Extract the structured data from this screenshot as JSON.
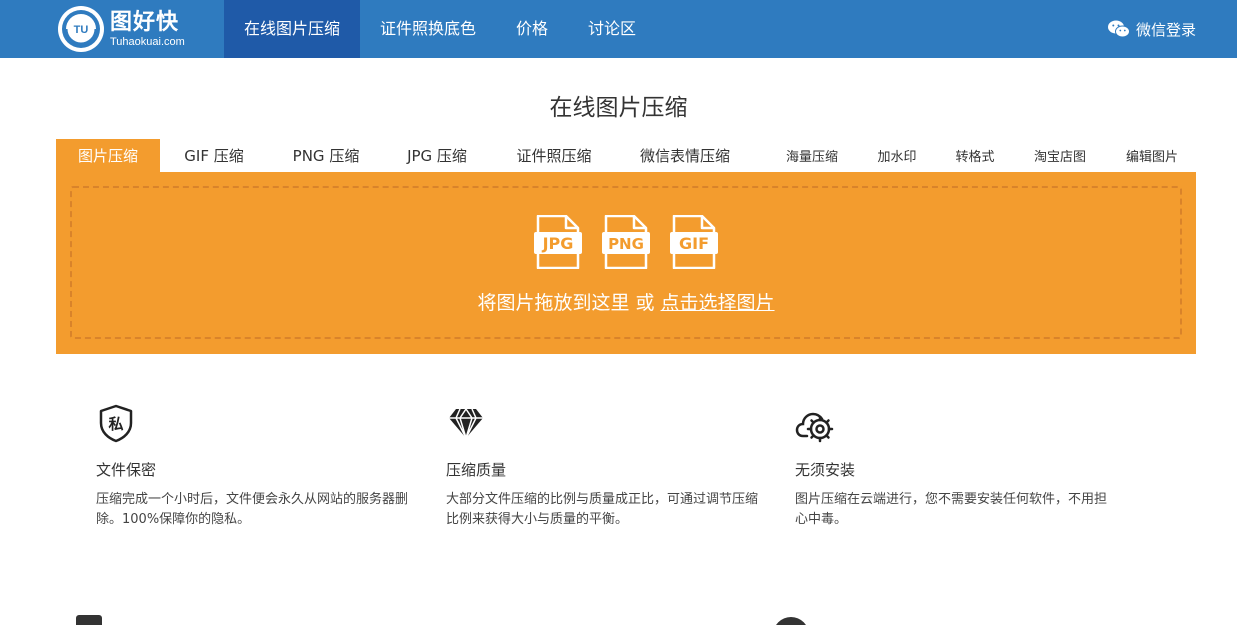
{
  "header": {
    "logo_cn": "图好快",
    "logo_en": "Tuhaokuai.com",
    "nav": [
      {
        "label": "在线图片压缩",
        "active": true
      },
      {
        "label": "证件照换底色",
        "active": false
      },
      {
        "label": "价格",
        "active": false
      },
      {
        "label": "讨论区",
        "active": false
      }
    ],
    "login_label": "微信登录"
  },
  "page_title": "在线图片压缩",
  "tabs": [
    {
      "label": "图片压缩",
      "active": true
    },
    {
      "label": "GIF 压缩"
    },
    {
      "label": "PNG 压缩"
    },
    {
      "label": "JPG 压缩"
    },
    {
      "label": "证件照压缩"
    },
    {
      "label": "微信表情压缩"
    },
    {
      "label": "海量压缩"
    },
    {
      "label": "加水印"
    },
    {
      "label": "转格式"
    },
    {
      "label": "淘宝店图"
    },
    {
      "label": "编辑图片"
    }
  ],
  "upload": {
    "formats": [
      "JPG",
      "PNG",
      "GIF"
    ],
    "drop_text": "将图片拖放到这里 或",
    "choose_link": "点击选择图片",
    "accent_color": "#f39c2e"
  },
  "features": [
    {
      "icon": "lock-badge-icon",
      "badge": "私",
      "title": "文件保密",
      "desc": "压缩完成一个小时后，文件便会永久从网站的服务器删除。100%保障你的隐私。"
    },
    {
      "icon": "diamond-icon",
      "title": "压缩质量",
      "desc": "大部分文件压缩的比例与质量成正比，可通过调节压缩比例来获得大小与质量的平衡。"
    },
    {
      "icon": "cloud-gear-icon",
      "title": "无须安装",
      "desc": "图片压缩在云端进行，您不需要安装任何软件，不用担心中毒。"
    }
  ],
  "colors": {
    "header": "#2f7bbf",
    "nav_active": "#1f5aa8",
    "accent": "#f39c2e"
  }
}
